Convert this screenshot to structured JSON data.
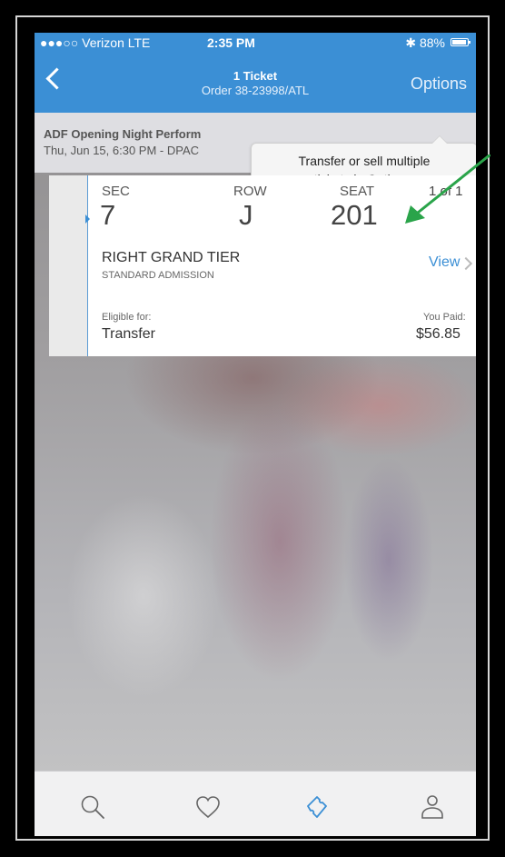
{
  "status_bar": {
    "carrier": "●●●○○ Verizon  LTE",
    "time": "2:35 PM",
    "battery": "✱ 88%"
  },
  "nav": {
    "title": "1 Ticket",
    "subtitle": "Order 38-23998/ATL",
    "options_label": "Options"
  },
  "event": {
    "name": "ADF Opening Night Perform",
    "datetime": "Thu, Jun 15, 6:30 PM - DPAC"
  },
  "tooltip": {
    "line1": "Transfer or sell multiple",
    "line2": "tickets in Options."
  },
  "ticket": {
    "sec_label": "SEC",
    "sec_value": "7",
    "row_label": "ROW",
    "row_value": "J",
    "seat_label": "SEAT",
    "seat_value": "201",
    "count": "1 of 1",
    "section_name": "RIGHT GRAND TIER",
    "admission": "STANDARD ADMISSION",
    "view_label": "View",
    "eligible_label": "Eligible for:",
    "eligible_value": "Transfer",
    "paid_label": "You Paid:",
    "paid_value": "$56.85"
  },
  "tabs": [
    {
      "icon": "search-icon"
    },
    {
      "icon": "heart-icon"
    },
    {
      "icon": "ticket-icon"
    },
    {
      "icon": "person-icon"
    }
  ],
  "colors": {
    "accent": "#3b8fd5",
    "annotation_arrow": "#2aa44a"
  }
}
